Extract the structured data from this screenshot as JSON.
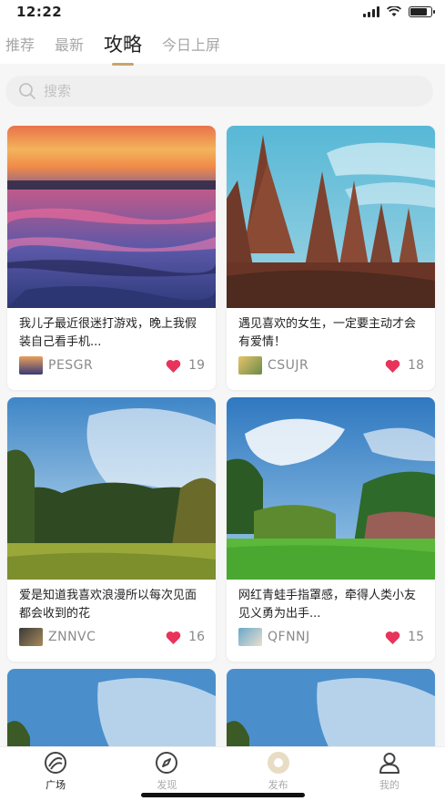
{
  "status": {
    "time": "12:22"
  },
  "tabs": [
    {
      "label": "推荐",
      "active": false
    },
    {
      "label": "最新",
      "active": false
    },
    {
      "label": "攻略",
      "active": true
    },
    {
      "label": "今日上屏",
      "active": false
    }
  ],
  "search": {
    "placeholder": "搜索"
  },
  "posts": [
    {
      "title": "我儿子最近很迷打游戏，晚上我假装自己看手机...",
      "author": "PESGR",
      "likes": "19"
    },
    {
      "title": "遇见喜欢的女生，一定要主动才会有爱情！",
      "author": "CSUJR",
      "likes": "18"
    },
    {
      "title": "爱是知道我喜欢浪漫所以每次见面都会收到的花",
      "author": "ZNNVC",
      "likes": "16"
    },
    {
      "title": "网红青蛙手指罩感，牵得人类小友见义勇为出手...",
      "author": "QFNNJ",
      "likes": "15"
    }
  ],
  "bottom_nav": [
    {
      "label": "广场",
      "icon": "plaza-icon",
      "active": true
    },
    {
      "label": "发现",
      "icon": "compass-icon",
      "active": false
    },
    {
      "label": "发布",
      "icon": "publish-icon",
      "active": false
    },
    {
      "label": "我的",
      "icon": "profile-icon",
      "active": false
    }
  ],
  "colors": {
    "accent": "#c9a56b",
    "like": "#e8335a"
  }
}
